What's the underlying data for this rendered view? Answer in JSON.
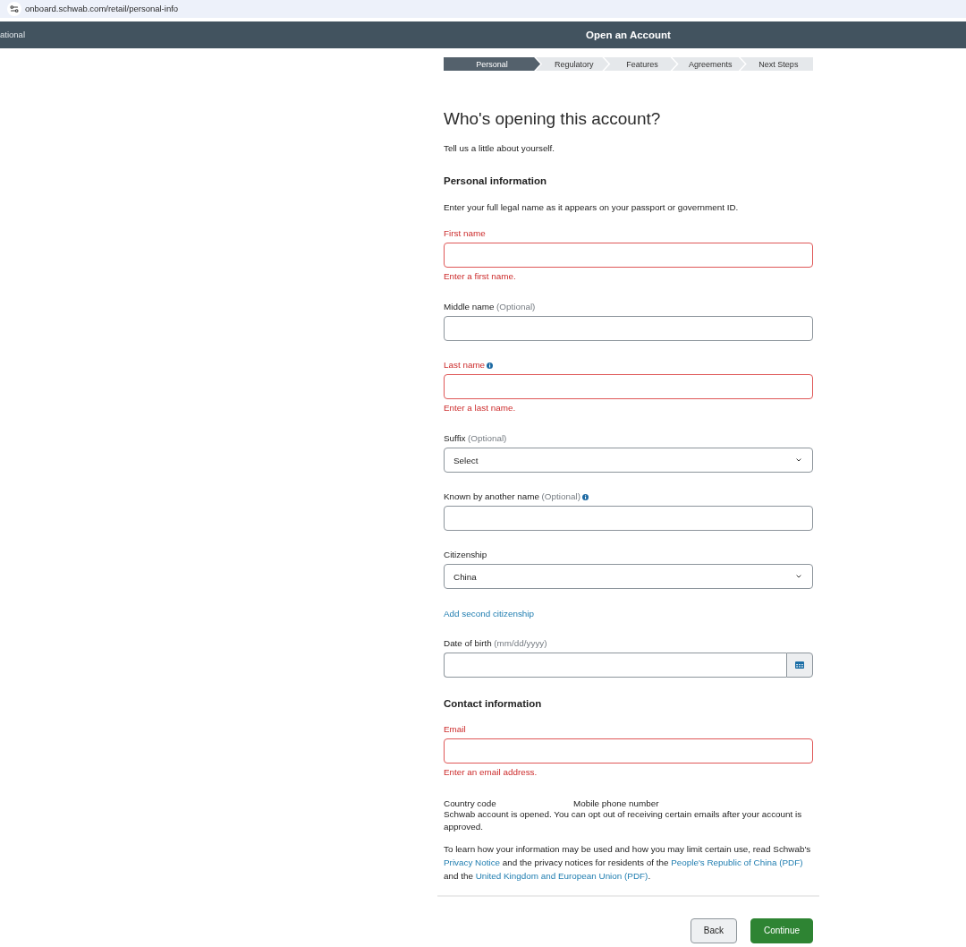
{
  "browser": {
    "url": "onboard.schwab.com/retail/personal-info"
  },
  "header": {
    "nav_text": "ational",
    "title": "Open an Account"
  },
  "steps": [
    {
      "label": "Personal",
      "selected": true
    },
    {
      "label": "Regulatory",
      "selected": false
    },
    {
      "label": "Features",
      "selected": false
    },
    {
      "label": "Agreements",
      "selected": false
    },
    {
      "label": "Next Steps",
      "selected": false
    }
  ],
  "page": {
    "title": "Who's opening this account?",
    "subtitle": "Tell us a little about yourself."
  },
  "form": [
    {
      "kind": "heading",
      "text": "Personal information"
    },
    {
      "kind": "paragraph",
      "text": "Enter your full legal name as it appears on your passport or government ID."
    },
    {
      "kind": "input",
      "label": "First name",
      "info": false,
      "invalid": true,
      "error": "Enter a first name."
    },
    {
      "kind": "input",
      "label": "Middle name",
      "hint": "(Optional)",
      "info": false,
      "invalid": false
    },
    {
      "kind": "input",
      "label": "Last name",
      "info": true,
      "invalid": true,
      "error": "Enter a last name."
    },
    {
      "kind": "select",
      "label": "Suffix",
      "hint": "(Optional)",
      "info": false,
      "invalid": false,
      "value": "Select"
    },
    {
      "kind": "input",
      "label": "Known by another name",
      "hint": "(Optional)",
      "info": true,
      "invalid": false
    },
    {
      "kind": "select",
      "label": "Citizenship",
      "info": false,
      "invalid": false,
      "value": "China"
    },
    {
      "kind": "link",
      "text": "Add second citizenship"
    },
    {
      "kind": "date",
      "label": "Date of birth",
      "hint": "(mm/dd/yyyy)",
      "info": false,
      "invalid": false
    },
    {
      "kind": "heading",
      "text": "Contact information"
    },
    {
      "kind": "input",
      "label": "Email",
      "info": false,
      "invalid": true,
      "error": "Enter an email address."
    },
    {
      "kind": "phone",
      "labels": [
        "Country code",
        "Mobile phone number"
      ]
    },
    {
      "kind": "paragraph",
      "text": "Schwab account is opened. You can opt out of receiving certain emails after your account is approved."
    },
    {
      "kind": "paragraph",
      "parts": [
        {
          "kind": "text",
          "text": "To learn how your information may be used and how you may limit certain use, read Schwab's "
        },
        {
          "kind": "link",
          "text": "Privacy Notice"
        },
        {
          "kind": "text",
          "text": " and the privacy notices for residents of the "
        },
        {
          "kind": "link",
          "text": "People's Republic of China (PDF)"
        },
        {
          "kind": "text",
          "text": " and the "
        },
        {
          "kind": "link",
          "text": "United Kingdom and European Union (PDF)"
        },
        {
          "kind": "text",
          "text": "."
        }
      ]
    }
  ],
  "buttons": [
    {
      "kind": "secondary",
      "label": "Back"
    },
    {
      "kind": "primary",
      "label": "Continue"
    }
  ]
}
